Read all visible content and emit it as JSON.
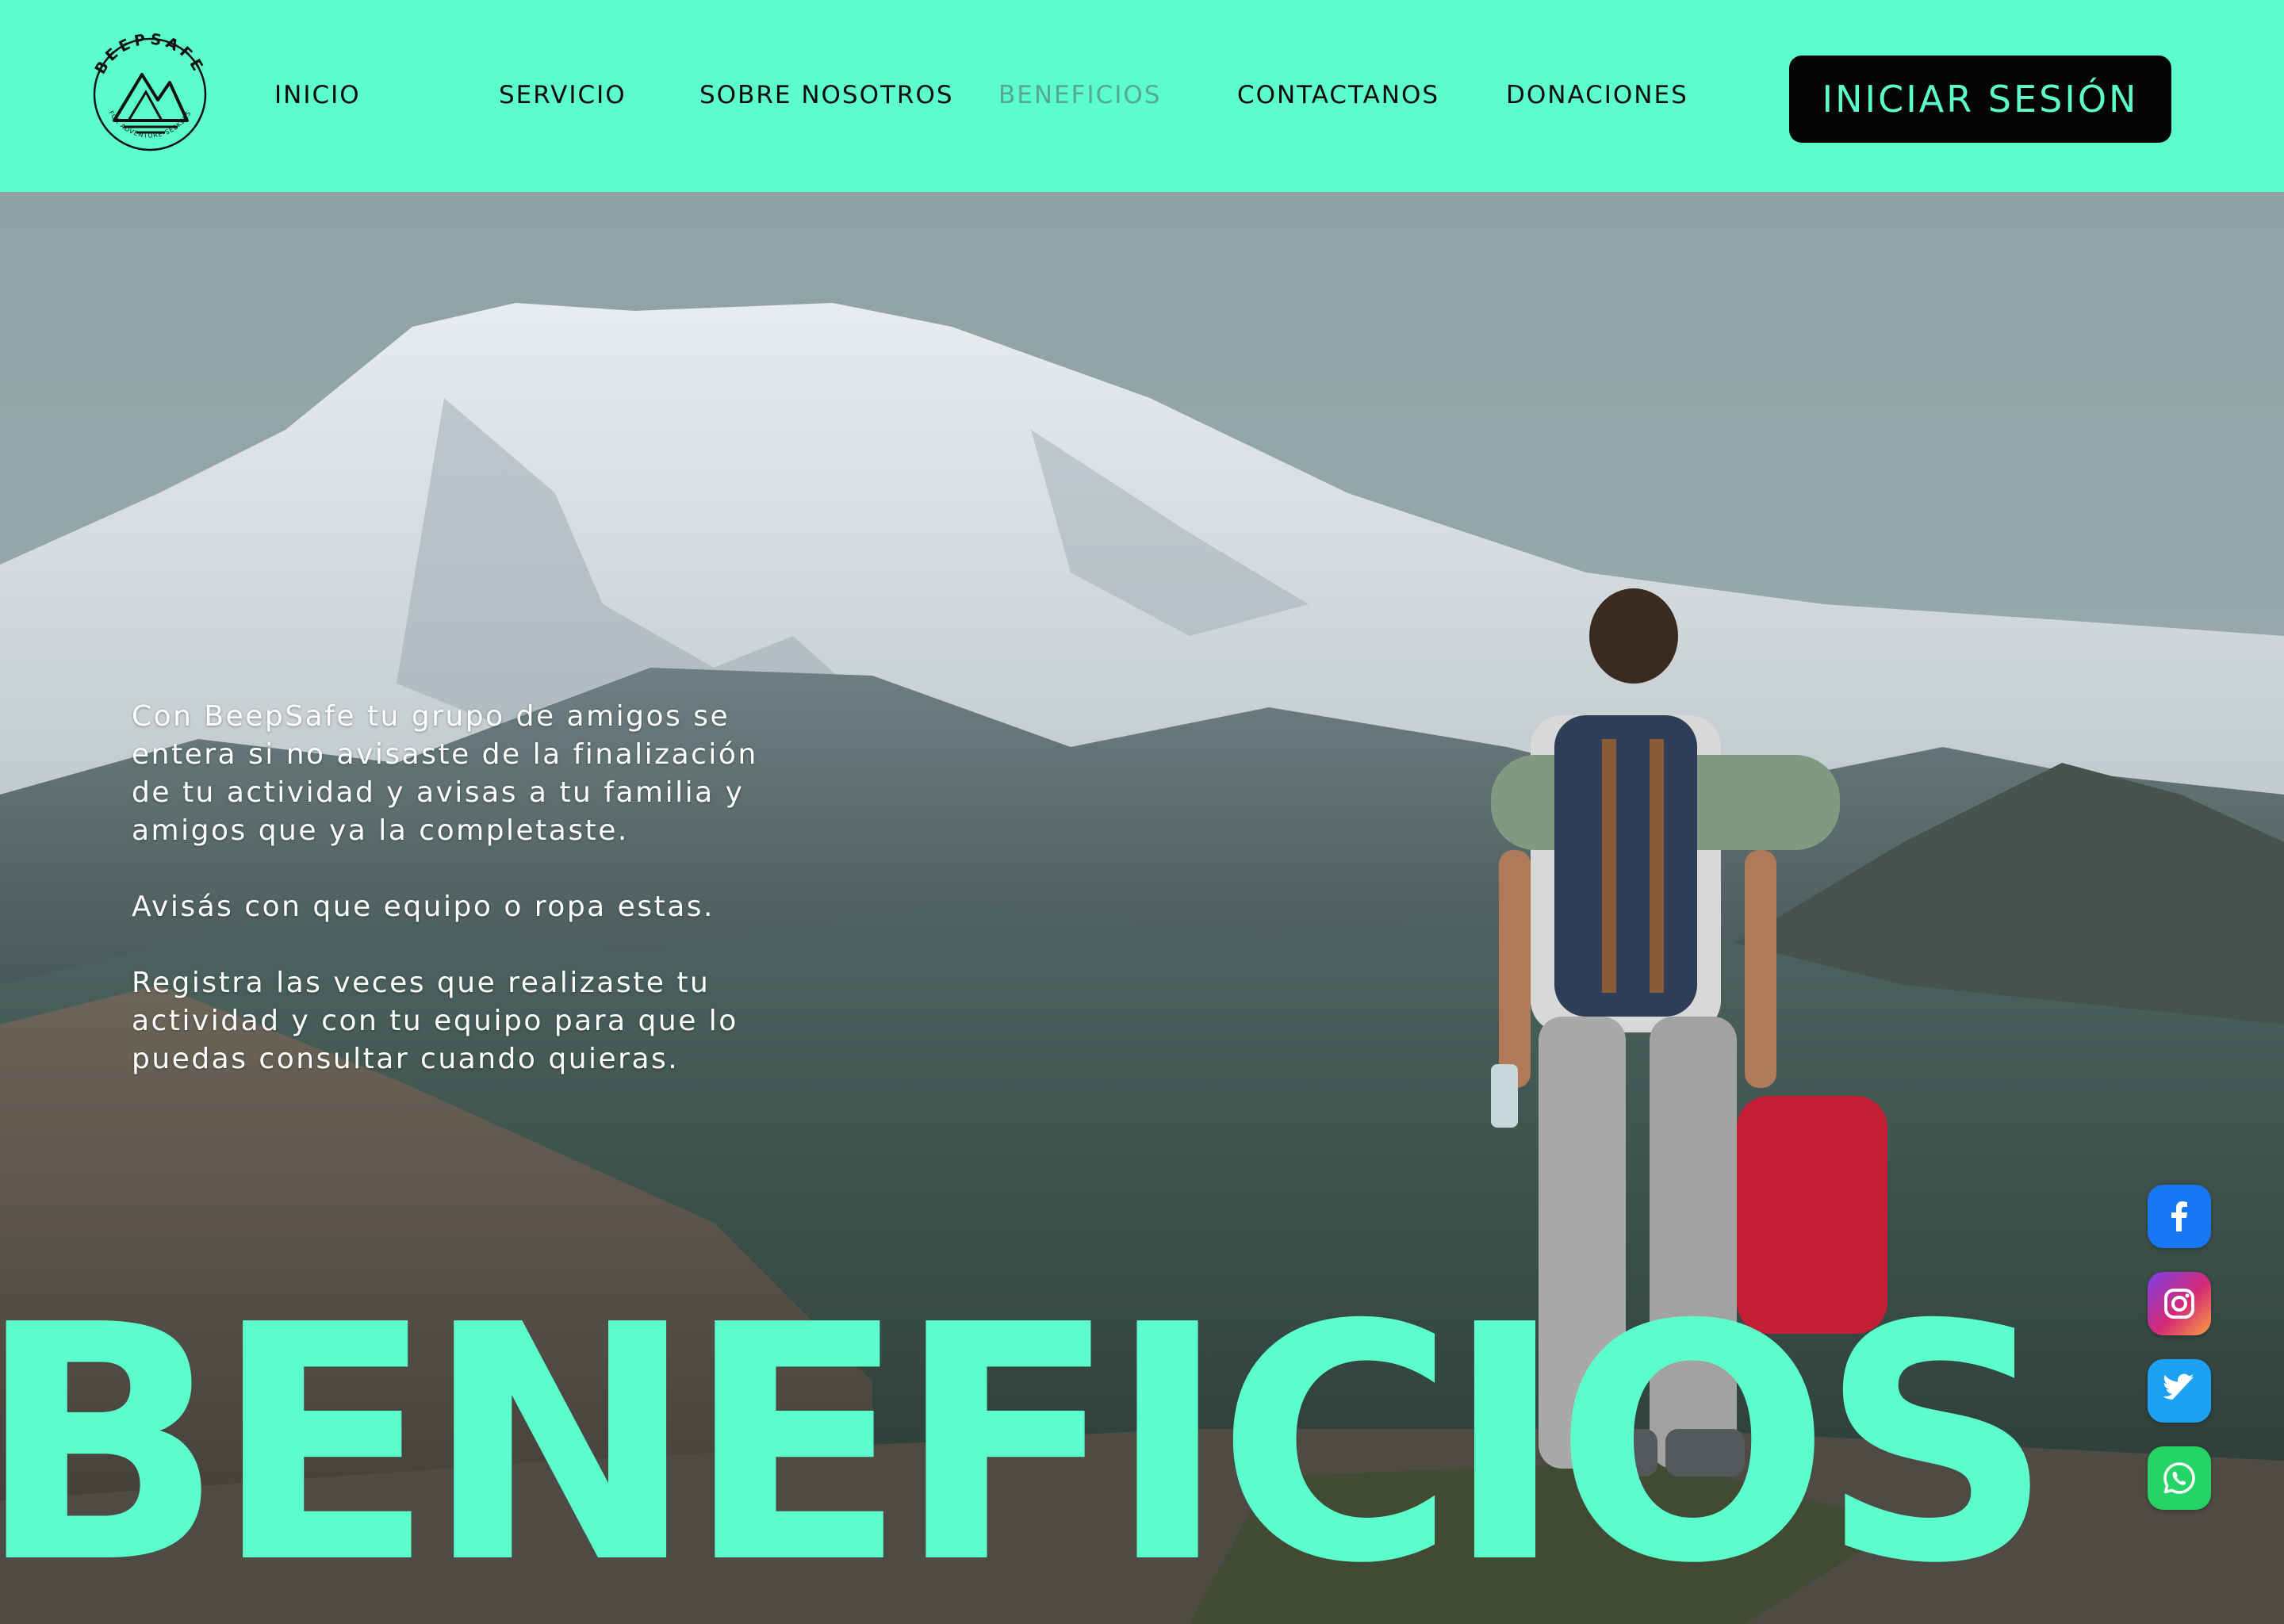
{
  "brand": {
    "name": "BEEPSAFE",
    "tagline": "FOR ADVENTURE-SEEKERS",
    "accent_color": "#5cffcc"
  },
  "nav": {
    "items": [
      {
        "label": "INICIO"
      },
      {
        "label": "SERVICIO"
      },
      {
        "label": "SOBRE NOSOTROS"
      },
      {
        "label": "BENEFICIOS",
        "active": true
      },
      {
        "label": "CONTACTANOS"
      },
      {
        "label": "DONACIONES"
      }
    ],
    "login_label": "INICIAR SESIÓN"
  },
  "hero": {
    "paragraphs": [
      "Con BeepSafe tu grupo de amigos se entera si no avisaste de la finalización de tu actividad y avisas a tu familia y amigos que ya la completaste.",
      "Avisás con que equipo o ropa estas.",
      "Registra las veces que realizaste tu actividad y con tu equipo para que lo puedas consultar cuando quieras."
    ],
    "title": "BENEFICIOS"
  },
  "social": [
    {
      "icon": "facebook-icon",
      "color": "#1877f2"
    },
    {
      "icon": "instagram-icon",
      "color": "#c13584"
    },
    {
      "icon": "twitter-icon",
      "color": "#1da1f2"
    },
    {
      "icon": "whatsapp-icon",
      "color": "#25d366"
    }
  ]
}
